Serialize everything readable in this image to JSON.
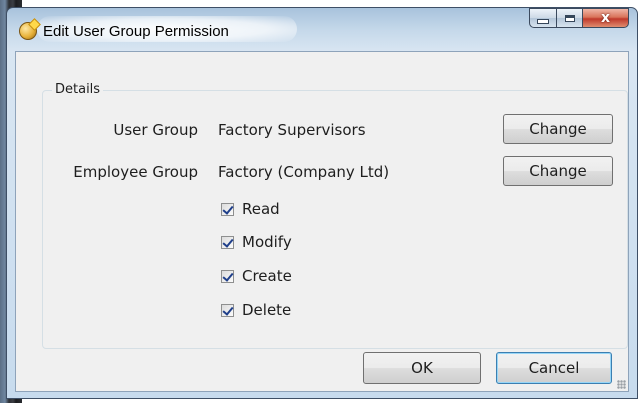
{
  "window": {
    "title": "Edit User Group Permission",
    "caption_buttons": {
      "minimize_icon": "minimize-icon",
      "maximize_icon": "maximize-icon",
      "close_glyph": "x"
    }
  },
  "details": {
    "legend": "Details",
    "user_group": {
      "label": "User Group",
      "value": "Factory Supervisors",
      "button": "Change"
    },
    "employee_group": {
      "label": "Employee Group",
      "value": "Factory (Company Ltd)",
      "button": "Change"
    },
    "permissions": [
      {
        "label": "Read",
        "checked": true
      },
      {
        "label": "Modify",
        "checked": true
      },
      {
        "label": "Create",
        "checked": true
      },
      {
        "label": "Delete",
        "checked": true
      }
    ]
  },
  "footer": {
    "ok": "OK",
    "cancel": "Cancel"
  }
}
